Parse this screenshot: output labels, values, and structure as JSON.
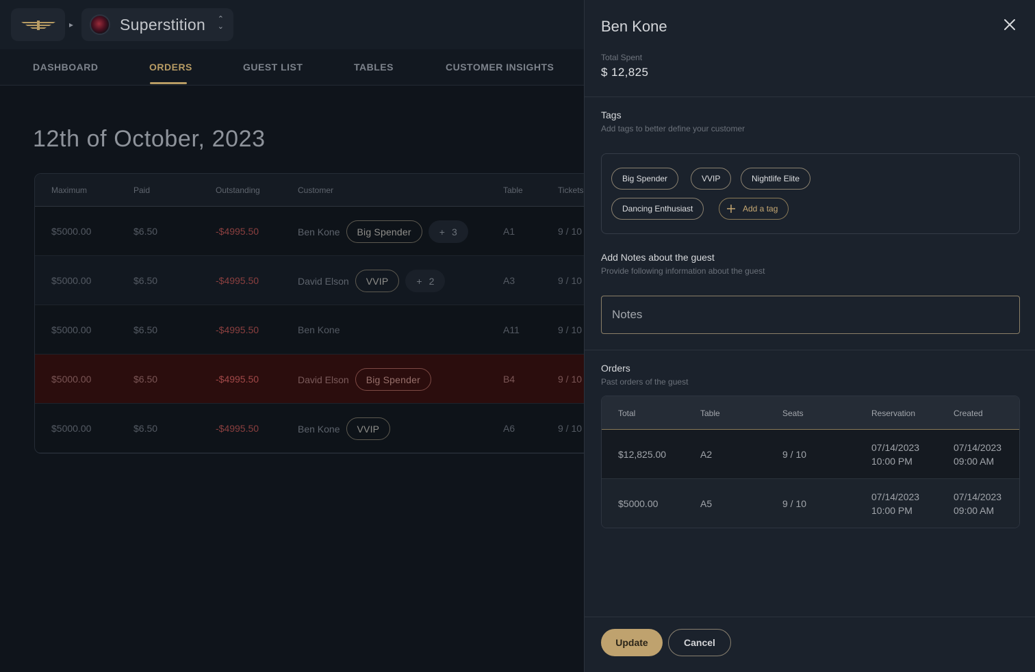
{
  "header": {
    "venue_name": "Superstition"
  },
  "nav": {
    "tabs": [
      "DASHBOARD",
      "ORDERS",
      "GUEST LIST",
      "TABLES",
      "CUSTOMER INSIGHTS"
    ],
    "active": "ORDERS"
  },
  "page": {
    "title": "12th of October, 2023"
  },
  "orders_table": {
    "columns": [
      "Maximum",
      "Paid",
      "Outstanding",
      "Customer",
      "Table",
      "Tickets"
    ],
    "rows": [
      {
        "maximum": "$5000.00",
        "paid": "$6.50",
        "outstanding": "-$4995.50",
        "customer": "Ben Kone",
        "tag": "Big Spender",
        "more": "3",
        "table": "A1",
        "tickets": "9 / 10"
      },
      {
        "maximum": "$5000.00",
        "paid": "$6.50",
        "outstanding": "-$4995.50",
        "customer": "David Elson",
        "tag": "VVIP",
        "more": "2",
        "table": "A3",
        "tickets": "9 / 10"
      },
      {
        "maximum": "$5000.00",
        "paid": "$6.50",
        "outstanding": "-$4995.50",
        "customer": "Ben Kone",
        "tag": "",
        "more": "",
        "table": "A11",
        "tickets": "9 / 10"
      },
      {
        "maximum": "$5000.00",
        "paid": "$6.50",
        "outstanding": "-$4995.50",
        "customer": "David Elson",
        "tag": "Big Spender",
        "more": "",
        "table": "B4",
        "tickets": "9 / 10"
      },
      {
        "maximum": "$5000.00",
        "paid": "$6.50",
        "outstanding": "-$4995.50",
        "customer": "Ben Kone",
        "tag": "VVIP",
        "more": "",
        "table": "A6",
        "tickets": "9 / 10"
      }
    ]
  },
  "drawer": {
    "guest_name": "Ben Kone",
    "total_spent_label": "Total Spent",
    "total_spent": "$ 12,825",
    "tags_title": "Tags",
    "tags_subtitle": "Add tags to better define your customer",
    "tags": [
      "Big Spender",
      "VVIP",
      "Nightlife Elite",
      "Dancing Enthusiast"
    ],
    "add_tag_label": "Add a tag",
    "notes_title": "Add Notes about the guest",
    "notes_subtitle": "Provide following information about the guest",
    "notes_placeholder": "Notes",
    "notes_value": "",
    "orders_title": "Orders",
    "orders_subtitle": "Past orders of the guest",
    "orders_columns": [
      "Total",
      "Table",
      "Seats",
      "Reservation",
      "Created"
    ],
    "orders": [
      {
        "total": "$12,825.00",
        "table": "A2",
        "seats": "9 / 10",
        "reservation_date": "07/14/2023",
        "reservation_time": "10:00 PM",
        "created_date": "07/14/2023",
        "created_time": "09:00 AM"
      },
      {
        "total": "$5000.00",
        "table": "A5",
        "seats": "9 / 10",
        "reservation_date": "07/14/2023",
        "reservation_time": "10:00 PM",
        "created_date": "07/14/2023",
        "created_time": "09:00 AM"
      }
    ],
    "update_label": "Update",
    "cancel_label": "Cancel"
  },
  "colors": {
    "accent_gold": "#bfa26e",
    "danger_row": "#2b0d0d",
    "drawer_bg": "#1b222c",
    "page_bg": "#0f141b"
  }
}
